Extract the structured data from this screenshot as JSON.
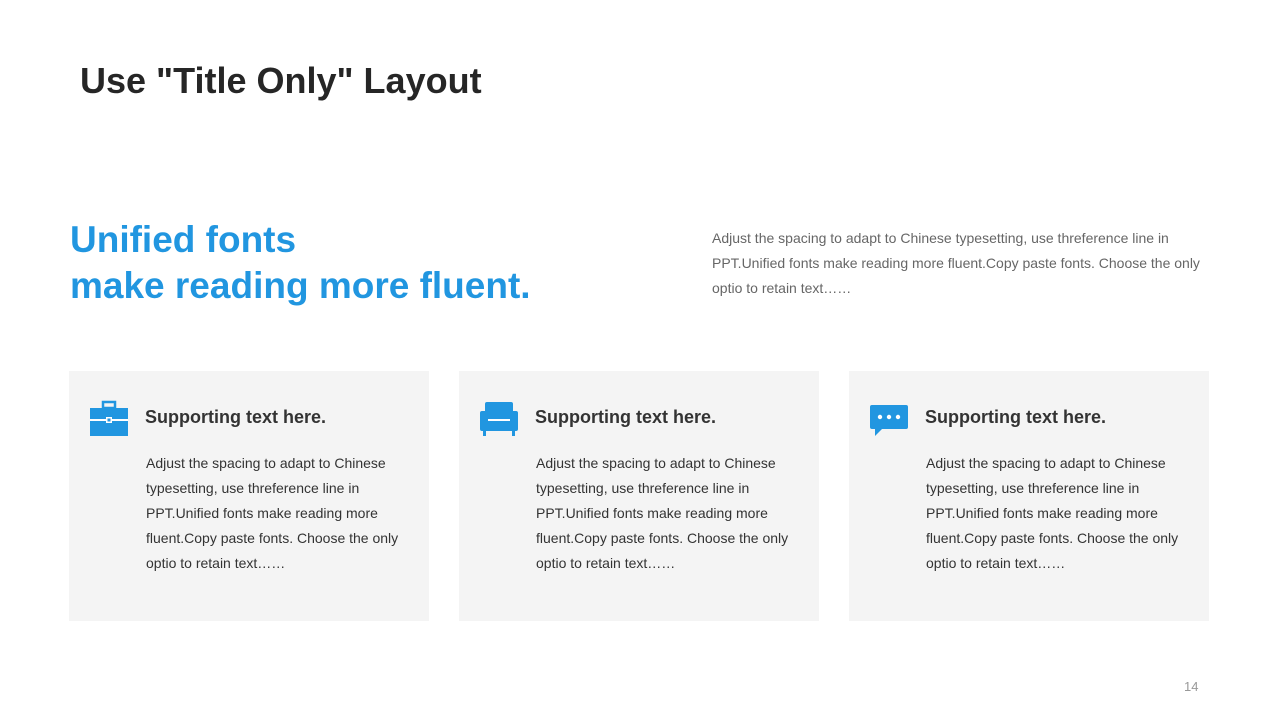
{
  "slide": {
    "title": "Use \"Title Only\" Layout",
    "headline": {
      "line1": "Unified fonts",
      "line2": "make reading more fluent."
    },
    "intro": "Adjust the spacing to adapt to Chinese typesetting, use threference line in PPT.Unified fonts make reading more fluent.Copy paste fonts. Choose the only optio to retain text……",
    "accent_color": "#2196e0",
    "cards": [
      {
        "icon": "toolbox-icon",
        "heading": "Supporting text here.",
        "body": "Adjust the spacing to adapt to Chinese typesetting, use threference line in PPT.Unified fonts make reading more fluent.Copy paste fonts. Choose the only optio to retain text……"
      },
      {
        "icon": "sofa-icon",
        "heading": "Supporting text here.",
        "body": "Adjust the spacing to adapt to Chinese typesetting, use threference line in PPT.Unified fonts make reading more fluent.Copy paste fonts. Choose the only optio to retain text……"
      },
      {
        "icon": "chat-bubble-icon",
        "heading": "Supporting text here.",
        "body": "Adjust the spacing to adapt to Chinese typesetting, use threference line in PPT.Unified fonts make reading more fluent.Copy paste fonts. Choose the only optio to retain text……"
      }
    ],
    "page_number": "14"
  }
}
